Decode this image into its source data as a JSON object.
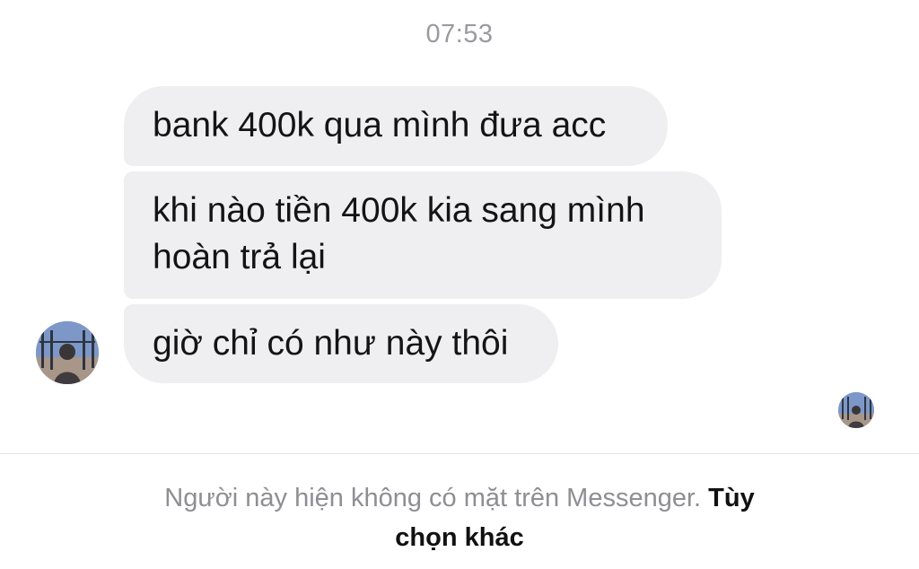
{
  "chat": {
    "timestamp": "07:53",
    "messages": [
      {
        "lines": [
          "bank 400k qua mình đưa acc"
        ]
      },
      {
        "lines": [
          "khi nào tiền 400k kia sang mình",
          "hoàn trả lại"
        ]
      },
      {
        "lines": [
          "giờ chỉ có như này thôi"
        ]
      }
    ],
    "sender_avatar_icon": "person-avatar-icon",
    "seen_avatar_icon": "seen-receipt-avatar-icon"
  },
  "footer": {
    "notice": "Người này hiện không có mặt trên Messenger. ",
    "more_options_line1": "Tùy",
    "more_options_line2": "chọn khác"
  },
  "colors": {
    "bubble_bg": "#efeff1",
    "text": "#141414",
    "muted": "#8e8e93"
  }
}
